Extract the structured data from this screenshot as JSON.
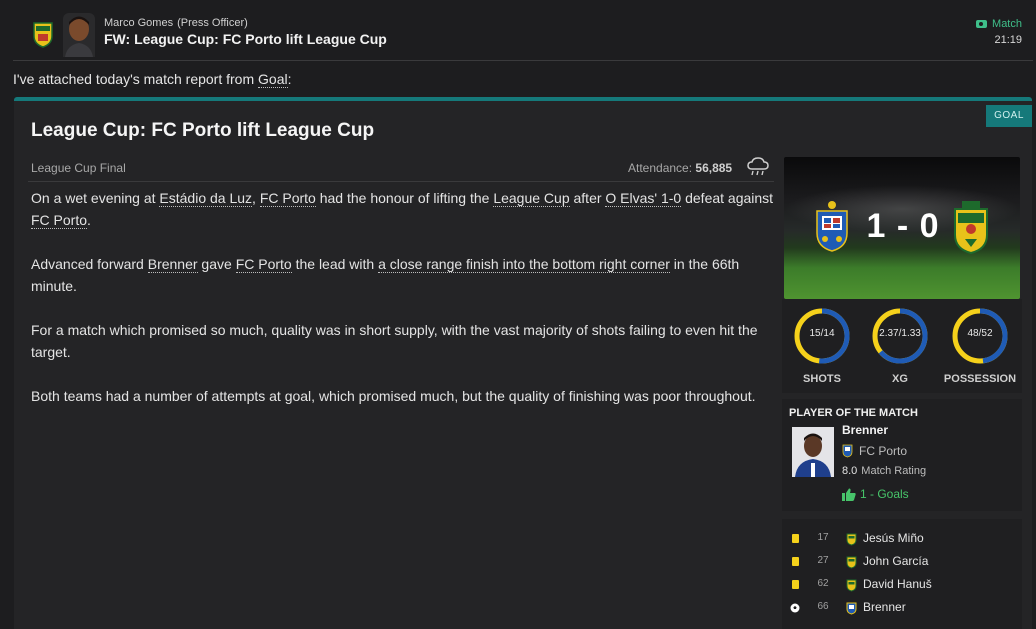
{
  "header": {
    "sender_name": "Marco Gomes",
    "sender_role": "(Press Officer)",
    "subject": "FW: League Cup: FC Porto lift League Cup",
    "tag": "Match",
    "time": "21:19"
  },
  "intro": {
    "text": "I've attached today's match report from ",
    "source": "Goal",
    "suffix": ":"
  },
  "article": {
    "tag": "GOAL",
    "title": "League Cup: FC Porto lift League Cup",
    "competition": "League Cup Final",
    "attendance_label": "Attendance:",
    "attendance_value": "56,885",
    "p1": {
      "a": "On a wet evening at ",
      "stadium": "Estádio da Luz",
      "b": ", ",
      "team1": "FC Porto",
      "c": " had the honour of lifting the ",
      "comp": "League Cup",
      "d": " after ",
      "team2": "O Elvas' 1-0",
      "e": " defeat against ",
      "team3": "FC Porto",
      "f": "."
    },
    "p2": {
      "a": "Advanced forward ",
      "player": "Brenner",
      "b": " gave ",
      "team": "FC Porto",
      "c": " the lead with ",
      "finish": "a close range finish into the bottom right corner",
      "d": " in the 66th minute."
    },
    "p3": "For a match which promised so much, quality was in short supply, with the vast majority of shots failing to even hit the target.",
    "p4": "Both teams had a number of attempts at goal, which promised much, but the quality of finishing was poor throughout."
  },
  "scoreboard": {
    "score": "1 - 0"
  },
  "stats": [
    {
      "value": "15/14",
      "label": "SHOTS",
      "home_share": 0.517
    },
    {
      "value": "2.37/1.33",
      "label": "XG",
      "home_share": 0.64
    },
    {
      "value": "48/52",
      "label": "POSSESSION",
      "home_share": 0.48
    }
  ],
  "potm": {
    "title": "PLAYER OF THE MATCH",
    "name": "Brenner",
    "club": "FC Porto",
    "rating_value": "8.0",
    "rating_label": "Match Rating",
    "goals": "1 - Goals"
  },
  "events": [
    {
      "type": "yellow-card",
      "minute": "17",
      "club": "O Elvas",
      "player": "Jesús Miño"
    },
    {
      "type": "yellow-card",
      "minute": "27",
      "club": "O Elvas",
      "player": "John García"
    },
    {
      "type": "yellow-card",
      "minute": "62",
      "club": "O Elvas",
      "player": "David Hanuš"
    },
    {
      "type": "goal",
      "minute": "66",
      "club": "FC Porto",
      "player": "Brenner"
    }
  ],
  "colors": {
    "accent_teal": "#15797a",
    "home_blue": "#1f5bb5",
    "away_yellow": "#f5d11b",
    "positive_green": "#47c46a"
  }
}
